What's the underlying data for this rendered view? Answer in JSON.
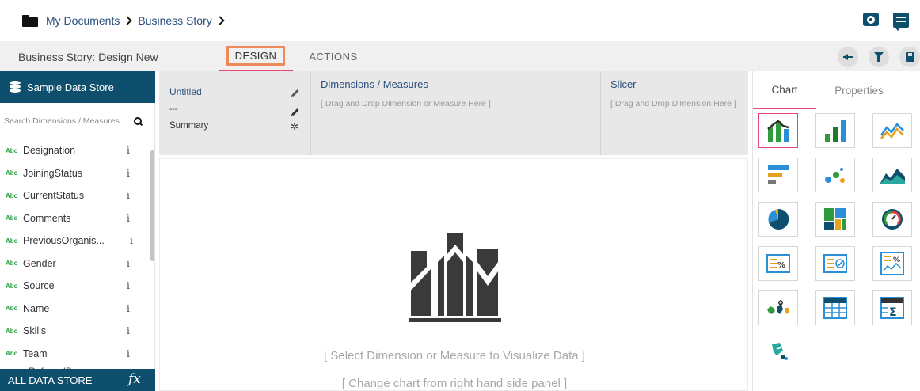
{
  "breadcrumb": {
    "root": "My Documents",
    "current": "Business Story"
  },
  "toolbar": {
    "story_title": "Business Story: Design New",
    "tabs": [
      "DESIGN",
      "ACTIONS"
    ],
    "active_tab": "DESIGN"
  },
  "sidebar": {
    "data_store": "Sample Data Store",
    "search_placeholder": "Search Dimensions / Measures",
    "type_badge": "Abc",
    "info_glyph": "i",
    "fields": [
      "Designation",
      "JoiningStatus",
      "CurrentStatus",
      "Comments",
      "PreviousOrganis...",
      "Gender",
      "Source",
      "Name",
      "Skills",
      "Team"
    ],
    "partial_field": "ReferredBy",
    "footer": "ALL DATA STORE",
    "fx_label": "fx"
  },
  "config": {
    "title": "Untitled",
    "subtitle": "---",
    "summary": "Summary",
    "dimensions_title": "Dimensions / Measures",
    "dimensions_hint": "[ Drag and Drop Dimension or Measure Here ]",
    "slicer_title": "Slicer",
    "slicer_hint": "[ Drag and Drop Dimension Here ]"
  },
  "canvas": {
    "message1": "[ Select Dimension or Measure to Visualize Data ]",
    "message2": "[ Change chart from right hand side panel ]"
  },
  "right_panel": {
    "tabs": [
      "Chart",
      "Properties"
    ],
    "active_tab": "Chart",
    "charts": [
      "combination-chart",
      "bar-chart",
      "line-chart",
      "horizontal-bar-chart",
      "scatter-chart",
      "area-chart",
      "pie-chart",
      "treemap-chart",
      "gauge-chart",
      "kpi-percent-chart",
      "kpi-target-chart",
      "kpi-trend-chart",
      "map-chart",
      "table-chart",
      "pivot-table-chart",
      "custom-chart"
    ],
    "selected_chart": "combination-chart"
  },
  "colors": {
    "primary": "#0e4f6e",
    "accent_pink": "#e8477a",
    "highlight_orange": "#ef8a5a",
    "abc_green": "#27a341"
  }
}
